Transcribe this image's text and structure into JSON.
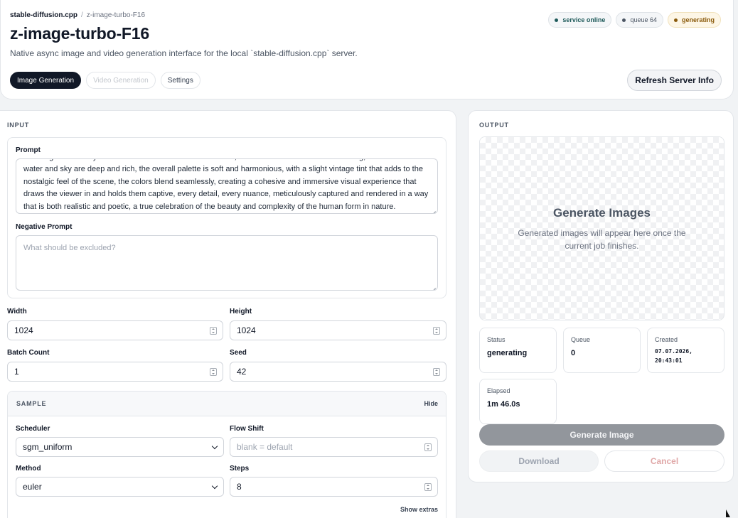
{
  "breadcrumb": {
    "root": "stable-diffusion.cpp",
    "separator": "/",
    "current": "z-image-turbo-F16"
  },
  "header": {
    "title": "z-image-turbo-F16",
    "subtitle": "Native async image and video generation interface for the local `stable-diffusion.cpp` server.",
    "refresh_label": "Refresh Server Info"
  },
  "badges": {
    "online": "service online",
    "queue": "queue 64",
    "generating": "generating"
  },
  "tabs": [
    {
      "label": "Image Generation",
      "state": "active"
    },
    {
      "label": "Video Generation",
      "state": "disabled"
    },
    {
      "label": "Settings",
      "state": "normal"
    }
  ],
  "input": {
    "section_label": "INPUT",
    "prompt_label": "Prompt",
    "prompt_value": "the image is carefully calibrated to enhance the natural tones, the skin tones are warm and inviting, the blues of the water and sky are deep and rich, the overall palette is soft and harmonious, with a slight vintage tint that adds to the nostalgic feel of the scene, the colors blend seamlessly, creating a cohesive and immersive visual experience that draws the viewer in and holds them captive, every detail, every nuance, meticulously captured and rendered in a way that is both realistic and poetic, a true celebration of the beauty and complexity of the human form in nature.",
    "negative_label": "Negative Prompt",
    "negative_placeholder": "What should be excluded?",
    "width_label": "Width",
    "width_value": "1024",
    "height_label": "Height",
    "height_value": "1024",
    "batch_label": "Batch Count",
    "batch_value": "1",
    "seed_label": "Seed",
    "seed_value": "42"
  },
  "sample": {
    "section_label": "SAMPLE",
    "hide_label": "Hide",
    "scheduler_label": "Scheduler",
    "scheduler_value": "sgm_uniform",
    "flow_shift_label": "Flow Shift",
    "flow_shift_placeholder": "blank = default",
    "method_label": "Method",
    "method_value": "euler",
    "steps_label": "Steps",
    "steps_value": "8",
    "show_extras_label": "Show extras"
  },
  "output": {
    "section_label": "OUTPUT",
    "preview_title": "Generate Images",
    "preview_text": "Generated images will appear here once the current job finishes.",
    "status_label": "Status",
    "status_value": "generating",
    "queue_label": "Queue",
    "queue_value": "0",
    "created_label": "Created",
    "created_date": "07.07.2026,",
    "created_time": "20:43:01",
    "elapsed_label": "Elapsed",
    "elapsed_value": "1m 46.0s",
    "generate_label": "Generate Image",
    "download_label": "Download",
    "cancel_label": "Cancel"
  },
  "colors": {
    "accent": "#111827",
    "online": "#1e5a5a",
    "generating": "#8a5a0b",
    "cancel": "#e0a8a8"
  }
}
